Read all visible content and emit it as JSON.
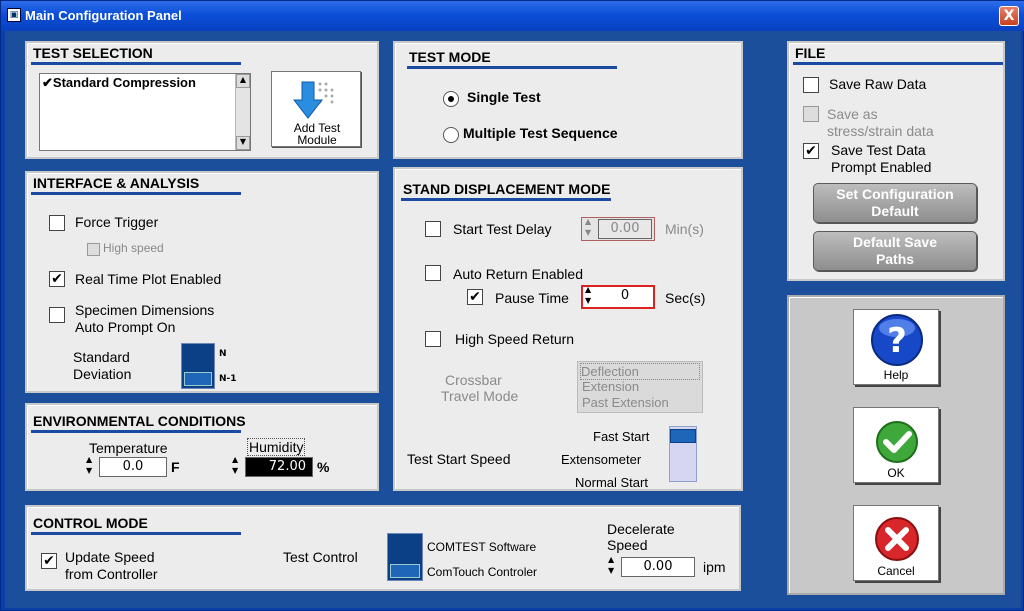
{
  "window": {
    "title": "Main Configuration Panel",
    "close_label": "X"
  },
  "test_selection": {
    "title": "TEST SELECTION",
    "list_items": [
      {
        "label": "Standard Compression",
        "checked": true
      }
    ],
    "add_button_label": "Add Test Module"
  },
  "test_mode": {
    "title": "TEST MODE",
    "options": [
      {
        "label": "Single Test",
        "selected": true
      },
      {
        "label": "Multiple Test Sequence",
        "selected": false
      }
    ]
  },
  "file": {
    "title": "FILE",
    "save_raw": "Save Raw Data",
    "save_stress_1": "Save as",
    "save_stress_2": "stress/strain data",
    "save_test_1": "Save Test Data",
    "save_test_2": "Prompt Enabled",
    "set_config_1": "Set Configuration",
    "set_config_2": "Default",
    "default_paths_1": "Default Save",
    "default_paths_2": "Paths"
  },
  "interface": {
    "title": "INTERFACE & ANALYSIS",
    "force_trigger": "Force Trigger",
    "high_speed": "High speed",
    "real_time": "Real Time Plot Enabled",
    "spec_dim_1": "Specimen Dimensions",
    "spec_dim_2": "Auto Prompt On",
    "std_dev_1": "Standard",
    "std_dev_2": "Deviation",
    "toggle_top": "N",
    "toggle_bottom": "N-1"
  },
  "stand": {
    "title": "STAND DISPLACEMENT MODE",
    "start_delay": "Start Test Delay",
    "start_delay_value": "0.00",
    "start_delay_unit": "Min(s)",
    "auto_return": "Auto Return Enabled",
    "pause_time": "Pause Time",
    "pause_value": "0",
    "pause_unit": "Sec(s)",
    "high_speed_return": "High Speed Return",
    "crossbar_1": "Crossbar",
    "crossbar_2": "Travel Mode",
    "travel_options": [
      "Deflection",
      "Extension",
      "Past Extension"
    ],
    "start_speed": "Test Start Speed",
    "speed_fast": "Fast Start",
    "speed_ext": "Extensometer",
    "speed_normal": "Normal Start"
  },
  "env": {
    "title": "ENVIRONMENTAL CONDITIONS",
    "temperature_label": "Temperature",
    "temperature_value": "0.0",
    "temperature_unit": "F",
    "humidity_label": "Humidity",
    "humidity_value": "72.00",
    "humidity_unit": "%"
  },
  "control": {
    "title": "CONTROL MODE",
    "update_1": "Update Speed",
    "update_2": "from Controller",
    "test_control": "Test Control",
    "opt_comtest": "COMTEST Software",
    "opt_comtouch": "ComTouch Controler",
    "decel_1": "Decelerate",
    "decel_2": "Speed",
    "decel_value": "0.00",
    "decel_unit": "ipm"
  },
  "actions": {
    "help": "Help",
    "ok": "OK",
    "cancel": "Cancel"
  },
  "colors": {
    "title_bar": "#0b4fd8",
    "panel": "#ececec",
    "accent_line": "#1c4aa0",
    "frame": "#1b4f9b"
  }
}
